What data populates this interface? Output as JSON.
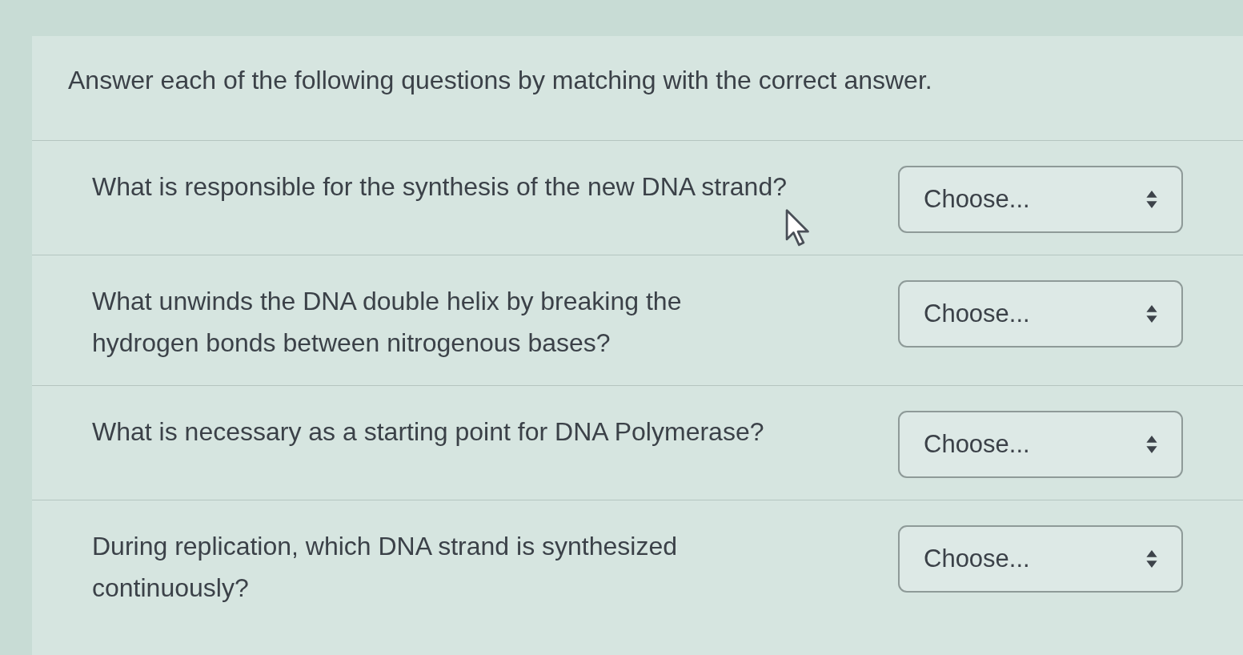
{
  "instructions": "Answer each of the following questions by matching with the correct answer.",
  "questions": [
    {
      "text": "What is responsible for the synthesis of the new DNA strand?",
      "dropdown": {
        "value": "Choose..."
      }
    },
    {
      "text": "What unwinds the DNA double helix by breaking the hydrogen bonds between nitrogenous bases?",
      "dropdown": {
        "value": "Choose..."
      }
    },
    {
      "text": "What is necessary as a starting point for DNA Polymerase?",
      "dropdown": {
        "value": "Choose..."
      }
    },
    {
      "text": "During replication, which DNA strand is synthesized continuously?",
      "dropdown": {
        "value": "Choose..."
      }
    }
  ]
}
